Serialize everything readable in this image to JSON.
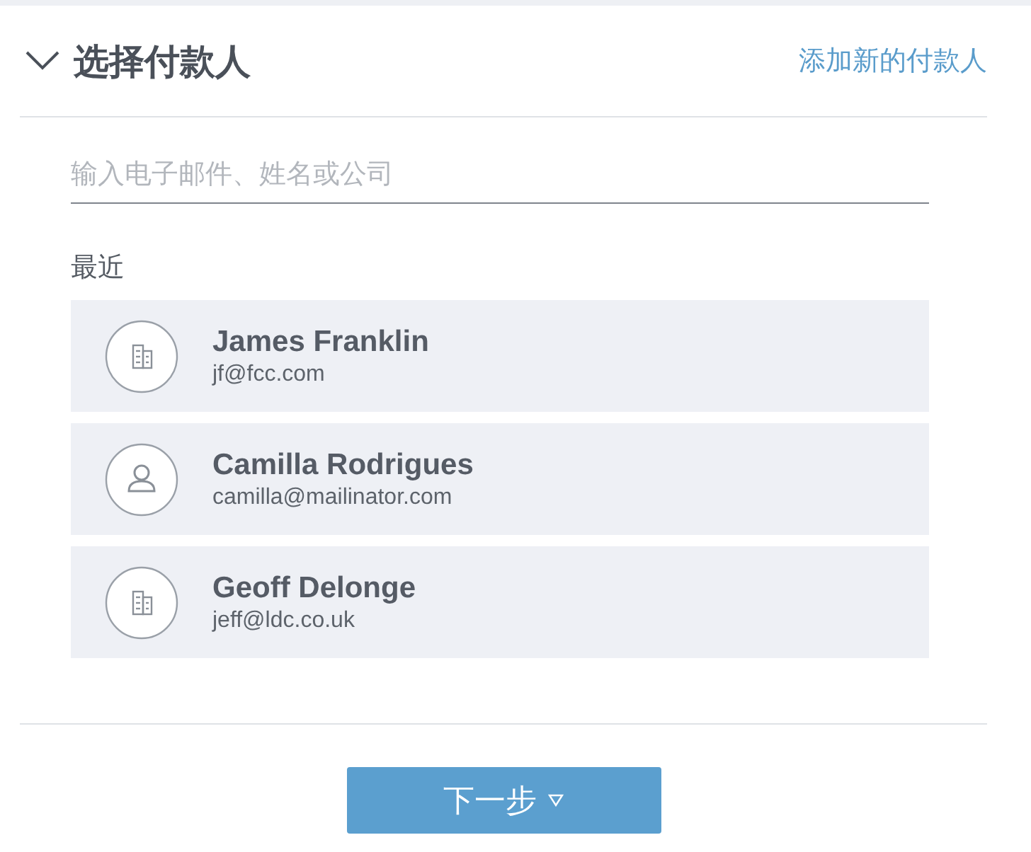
{
  "header": {
    "title": "选择付款人",
    "expanded": true,
    "add_link": "添加新的付款人"
  },
  "search": {
    "placeholder": "输入电子邮件、姓名或公司"
  },
  "recent": {
    "label": "最近",
    "payers": [
      {
        "kind": "company",
        "name": "James Franklin",
        "email": "jf@fcc.com"
      },
      {
        "kind": "person",
        "name": "Camilla Rodrigues",
        "email": "camilla@mailinator.com"
      },
      {
        "kind": "company",
        "name": "Geoff Delonge",
        "email": "jeff@ldc.co.uk"
      }
    ]
  },
  "next_button": {
    "label": "下一步"
  }
}
